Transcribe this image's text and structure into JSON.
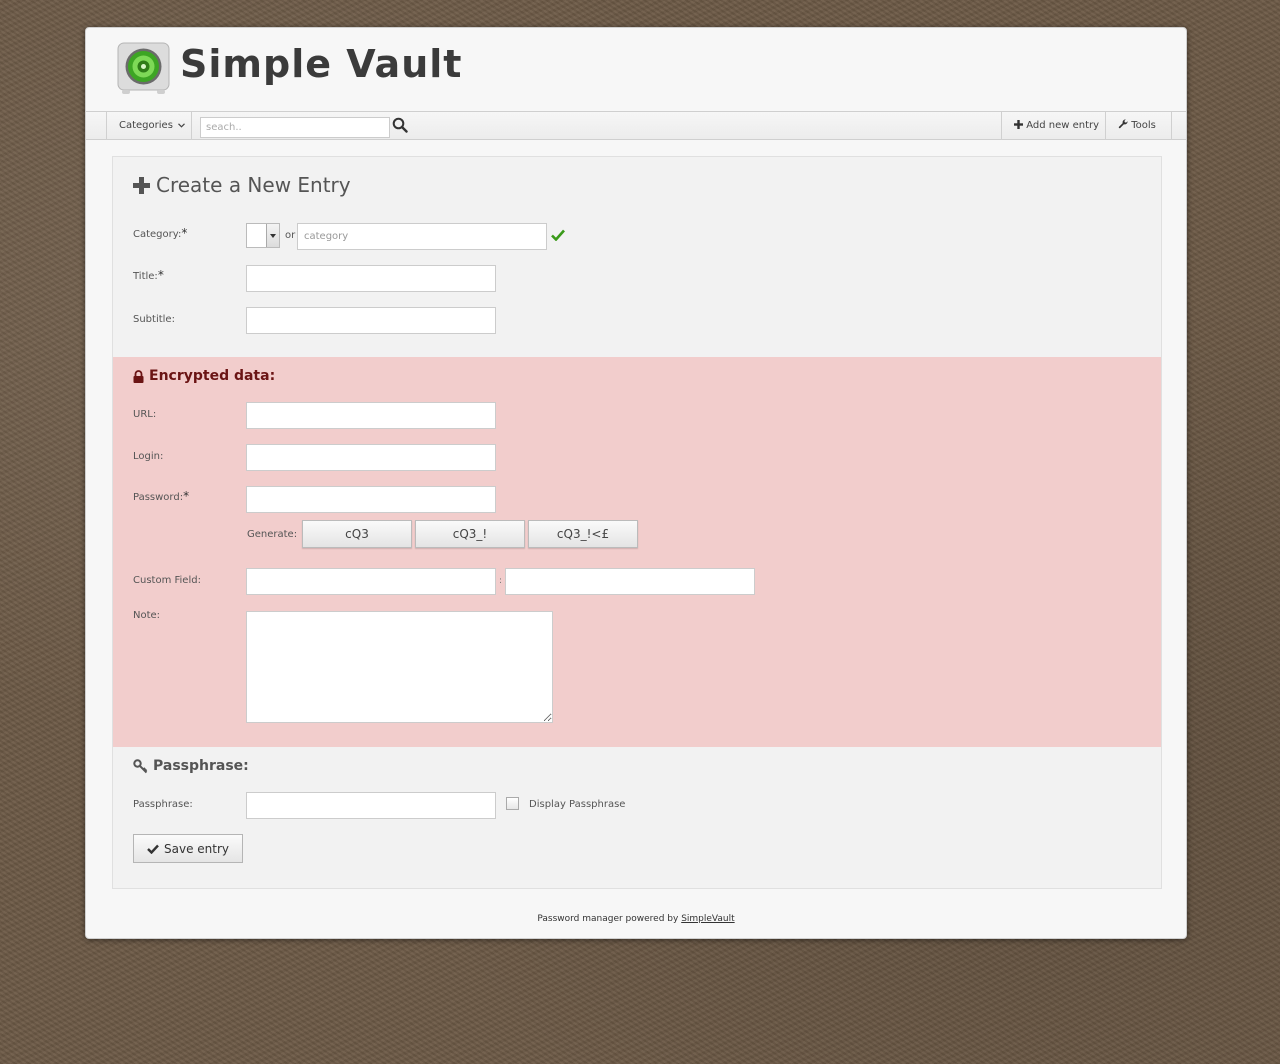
{
  "app": {
    "logo_text": "Simple Vault"
  },
  "navbar": {
    "categories_label": "Categories",
    "search_placeholder": "seach..",
    "add_entry_label": "Add new entry",
    "tools_label": "Tools"
  },
  "form": {
    "title": "Create a New Entry",
    "category_label": "Category:",
    "required_mark": "*",
    "or_text": "or",
    "category_placeholder": "category",
    "title_label": "Title:",
    "subtitle_label": "Subtitle:",
    "encrypted": {
      "heading": "Encrypted data:",
      "url_label": "URL:",
      "login_label": "Login:",
      "password_label": "Password:",
      "generate_label": "Generate:",
      "generate_buttons": [
        "cQ3",
        "cQ3_!",
        "cQ3_!<£"
      ],
      "custom_field_label": "Custom Field:",
      "custom_separator": ":",
      "note_label": "Note:"
    },
    "passphrase": {
      "heading": "Passphrase:",
      "label": "Passphrase:",
      "display_label": "Display Passphrase",
      "save_label": "Save entry"
    }
  },
  "footer": {
    "text": "Password manager powered by",
    "link": "SimpleVault"
  },
  "colors": {
    "accent_check": "#3a9a1a",
    "encrypted_bg": "#f2cdcc",
    "encrypted_heading": "#6b1414"
  }
}
